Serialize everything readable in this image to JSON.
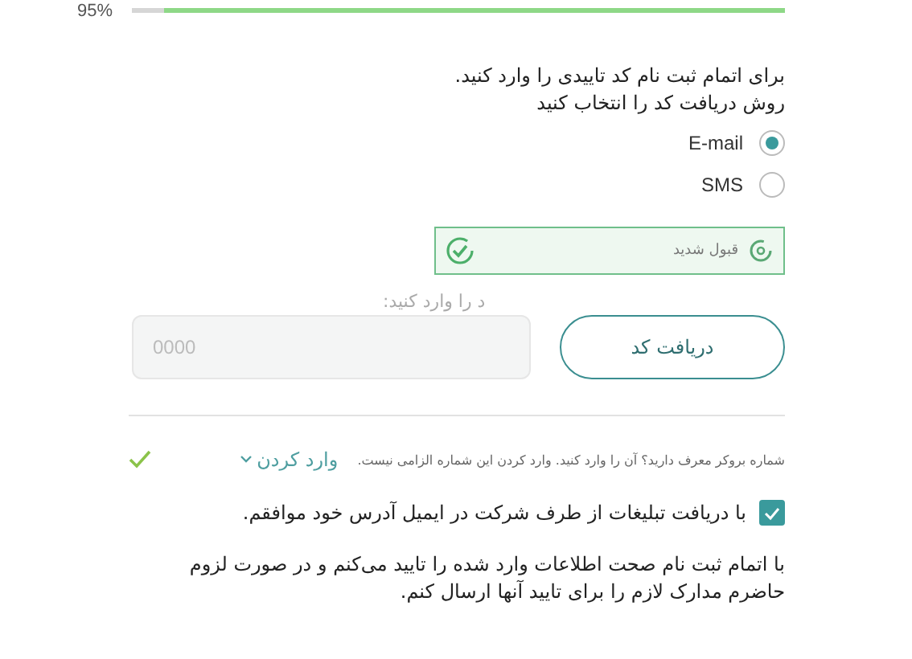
{
  "progress": {
    "label": "95%",
    "level": 0.95
  },
  "intro": [
    "برای اتمام ثبت نام کد تاییدی را وارد کنید.",
    "روش دریافت کد را انتخاب کنید"
  ],
  "methods": [
    {
      "label": "E-mail",
      "selected": true
    },
    {
      "label": "SMS",
      "selected": false
    }
  ],
  "captcha": {
    "text": "قبول شدید",
    "verified": true
  },
  "code": {
    "label": "د را وارد کنید:",
    "placeholder": "0000",
    "button": "دریافت کد"
  },
  "broker": {
    "text": "شماره بروکر معرف دارید؟ آن را وارد کنید. وارد کردن این شماره الزامی نیست.",
    "link": "وارد کردن",
    "done": true
  },
  "consent": {
    "label": "با دریافت تبلیغات از طرف شرکت در ایمیل آدرس خود موافقم.",
    "checked": true
  },
  "terms": "با اتمام ثبت نام صحت اطلاعات وارد شده را تایید می‌کنم و در صورت لزوم حاضرم مدارک لازم را برای تایید آنها ارسال کنم."
}
